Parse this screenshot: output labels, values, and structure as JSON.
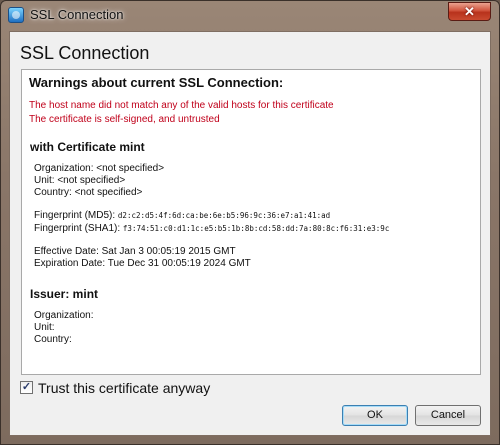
{
  "window": {
    "title": "SSL Connection",
    "close_glyph": "✕",
    "icon": "ssl-app-icon"
  },
  "dialog": {
    "heading": "SSL Connection",
    "panel_title": "Warnings about current SSL Connection:",
    "warnings": [
      "The host name did not match any of the valid hosts for this certificate",
      "The certificate is self-signed, and untrusted"
    ],
    "certificate": {
      "title": "with Certificate mint",
      "organization": "Organization: <not specified>",
      "unit": "Unit: <not specified>",
      "country": "Country: <not specified>",
      "md5_label": "Fingerprint (MD5):",
      "md5": "d2:c2:d5:4f:6d:ca:be:6e:b5:96:9c:36:e7:a1:41:ad",
      "sha1_label": "Fingerprint (SHA1):",
      "sha1": "f3:74:51:c0:d1:1c:e5:b5:1b:8b:cd:58:dd:7a:80:8c:f6:31:e3:9c",
      "effective": "Effective Date: Sat Jan 3 00:05:19 2015 GMT",
      "expiration": "Expiration Date: Tue Dec 31 00:05:19 2024 GMT"
    },
    "issuer": {
      "title": "Issuer: mint",
      "organization": "Organization:",
      "unit": "Unit:",
      "country": "Country:"
    }
  },
  "footer": {
    "trust_label": "Trust this certificate anyway",
    "trust_checked": true,
    "check_glyph": "✓",
    "ok_label": "OK",
    "cancel_label": "Cancel"
  }
}
